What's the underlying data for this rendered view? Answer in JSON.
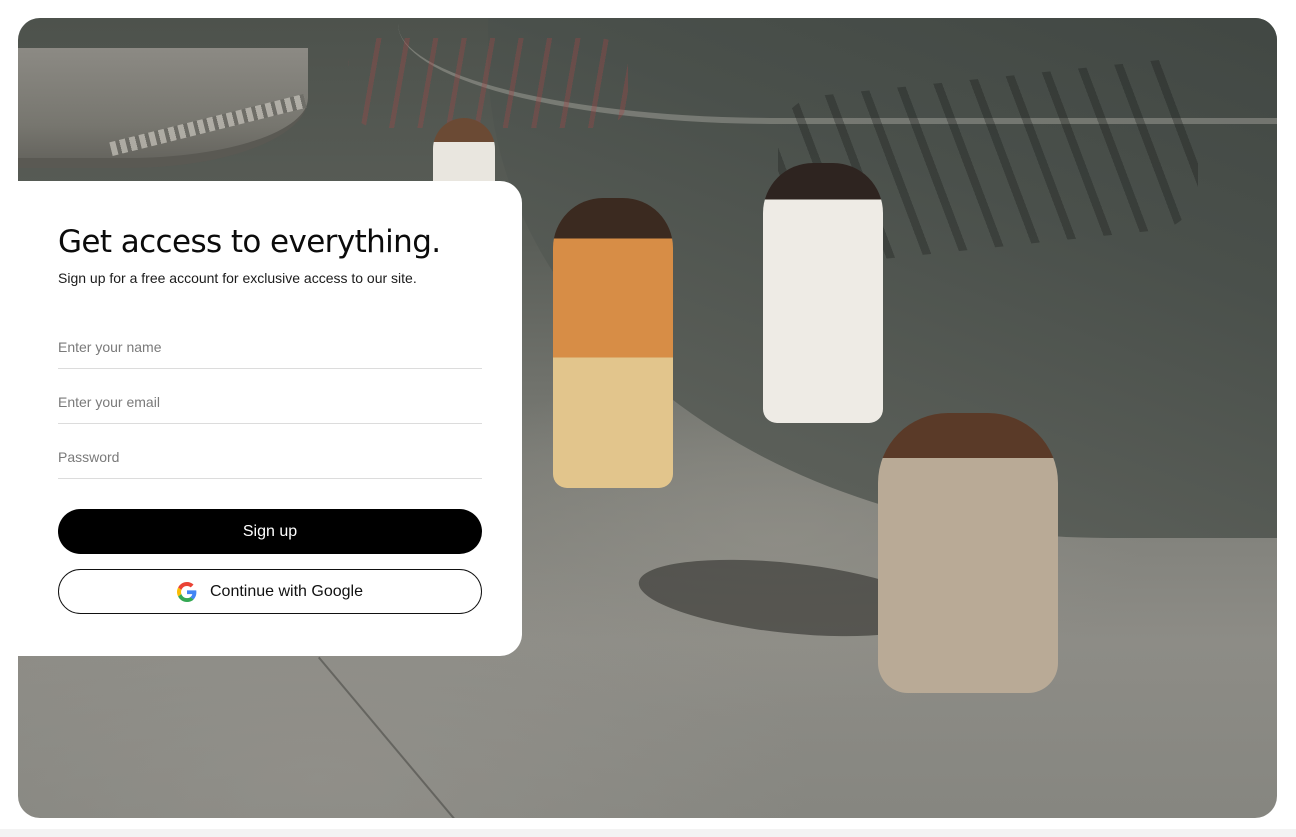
{
  "signup": {
    "title": "Get access to everything.",
    "subtitle": "Sign up for a free account for exclusive access to our site.",
    "name_placeholder": "Enter your name",
    "email_placeholder": "Enter your email",
    "password_placeholder": "Password",
    "signup_label": "Sign up",
    "google_label": "Continue with Google",
    "google_icon": "google-icon"
  },
  "colors": {
    "primary_button": "#000000",
    "primary_button_text": "#ffffff",
    "card_background": "#ffffff"
  }
}
